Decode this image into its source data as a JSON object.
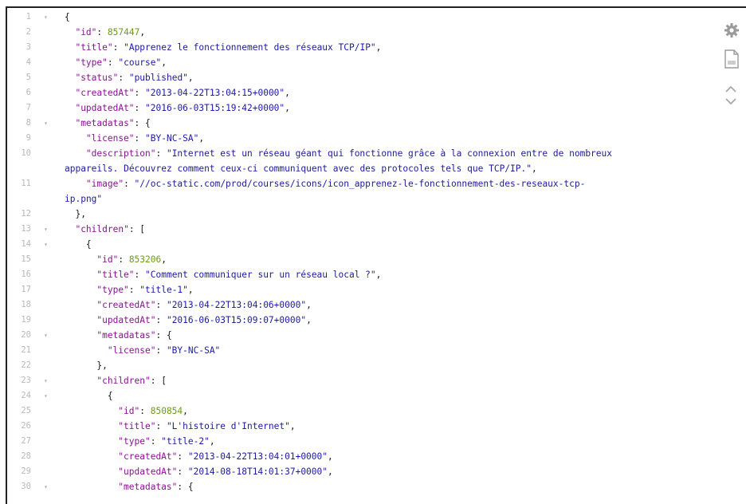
{
  "lines": [
    {
      "n": "1",
      "fold": true,
      "parts": [
        [
          "p",
          "{"
        ]
      ],
      "indent": 0
    },
    {
      "n": "2",
      "parts": [
        [
          "k",
          "\"id\""
        ],
        [
          "p",
          ": "
        ],
        [
          "n",
          "857447"
        ],
        [
          "p",
          ","
        ]
      ],
      "indent": 1
    },
    {
      "n": "3",
      "parts": [
        [
          "k",
          "\"title\""
        ],
        [
          "p",
          ": "
        ],
        [
          "s",
          "\"Apprenez le fonctionnement des réseaux TCP/IP\""
        ],
        [
          "p",
          ","
        ]
      ],
      "indent": 1
    },
    {
      "n": "4",
      "parts": [
        [
          "k",
          "\"type\""
        ],
        [
          "p",
          ": "
        ],
        [
          "s",
          "\"course\""
        ],
        [
          "p",
          ","
        ]
      ],
      "indent": 1
    },
    {
      "n": "5",
      "parts": [
        [
          "k",
          "\"status\""
        ],
        [
          "p",
          ": "
        ],
        [
          "s",
          "\"published\""
        ],
        [
          "p",
          ","
        ]
      ],
      "indent": 1
    },
    {
      "n": "6",
      "parts": [
        [
          "k",
          "\"createdAt\""
        ],
        [
          "p",
          ": "
        ],
        [
          "s",
          "\"2013-04-22T13:04:15+0000\""
        ],
        [
          "p",
          ","
        ]
      ],
      "indent": 1
    },
    {
      "n": "7",
      "parts": [
        [
          "k",
          "\"updatedAt\""
        ],
        [
          "p",
          ": "
        ],
        [
          "s",
          "\"2016-06-03T15:19:42+0000\""
        ],
        [
          "p",
          ","
        ]
      ],
      "indent": 1
    },
    {
      "n": "8",
      "fold": true,
      "parts": [
        [
          "k",
          "\"metadatas\""
        ],
        [
          "p",
          ": {"
        ]
      ],
      "indent": 1
    },
    {
      "n": "9",
      "parts": [
        [
          "k",
          "\"license\""
        ],
        [
          "p",
          ": "
        ],
        [
          "s",
          "\"BY-NC-SA\""
        ],
        [
          "p",
          ","
        ]
      ],
      "indent": 2
    },
    {
      "n": "10",
      "parts": [
        [
          "k",
          "\"description\""
        ],
        [
          "p",
          ": "
        ],
        [
          "s",
          "\"Internet est un réseau géant qui fonctionne grâce à la connexion entre de nombreux"
        ]
      ],
      "indent": 2
    },
    {
      "n": "",
      "cont": true,
      "parts": [
        [
          "s",
          "appareils. Découvrez comment ceux-ci communiquent avec des protocoles tels que TCP/IP.\""
        ],
        [
          "p",
          ","
        ]
      ],
      "indent": 0
    },
    {
      "n": "11",
      "parts": [
        [
          "k",
          "\"image\""
        ],
        [
          "p",
          ": "
        ],
        [
          "s",
          "\"//oc-static.com/prod/courses/icons/icon_apprenez-le-fonctionnement-des-reseaux-tcp-"
        ]
      ],
      "indent": 2
    },
    {
      "n": "",
      "cont": true,
      "parts": [
        [
          "s",
          "ip.png\""
        ]
      ],
      "indent": 0
    },
    {
      "n": "12",
      "parts": [
        [
          "p",
          "},"
        ]
      ],
      "indent": 1
    },
    {
      "n": "13",
      "fold": true,
      "parts": [
        [
          "k",
          "\"children\""
        ],
        [
          "p",
          ": ["
        ]
      ],
      "indent": 1
    },
    {
      "n": "14",
      "fold": true,
      "parts": [
        [
          "p",
          "{"
        ]
      ],
      "indent": 2
    },
    {
      "n": "15",
      "parts": [
        [
          "k",
          "\"id\""
        ],
        [
          "p",
          ": "
        ],
        [
          "n",
          "853206"
        ],
        [
          "p",
          ","
        ]
      ],
      "indent": 3
    },
    {
      "n": "16",
      "parts": [
        [
          "k",
          "\"title\""
        ],
        [
          "p",
          ": "
        ],
        [
          "s",
          "\"Comment communiquer sur un réseau local ?\""
        ],
        [
          "p",
          ","
        ]
      ],
      "indent": 3
    },
    {
      "n": "17",
      "parts": [
        [
          "k",
          "\"type\""
        ],
        [
          "p",
          ": "
        ],
        [
          "s",
          "\"title-1\""
        ],
        [
          "p",
          ","
        ]
      ],
      "indent": 3
    },
    {
      "n": "18",
      "parts": [
        [
          "k",
          "\"createdAt\""
        ],
        [
          "p",
          ": "
        ],
        [
          "s",
          "\"2013-04-22T13:04:06+0000\""
        ],
        [
          "p",
          ","
        ]
      ],
      "indent": 3
    },
    {
      "n": "19",
      "parts": [
        [
          "k",
          "\"updatedAt\""
        ],
        [
          "p",
          ": "
        ],
        [
          "s",
          "\"2016-06-03T15:09:07+0000\""
        ],
        [
          "p",
          ","
        ]
      ],
      "indent": 3
    },
    {
      "n": "20",
      "fold": true,
      "parts": [
        [
          "k",
          "\"metadatas\""
        ],
        [
          "p",
          ": {"
        ]
      ],
      "indent": 3
    },
    {
      "n": "21",
      "parts": [
        [
          "k",
          "\"license\""
        ],
        [
          "p",
          ": "
        ],
        [
          "s",
          "\"BY-NC-SA\""
        ]
      ],
      "indent": 4
    },
    {
      "n": "22",
      "parts": [
        [
          "p",
          "},"
        ]
      ],
      "indent": 3
    },
    {
      "n": "23",
      "fold": true,
      "parts": [
        [
          "k",
          "\"children\""
        ],
        [
          "p",
          ": ["
        ]
      ],
      "indent": 3
    },
    {
      "n": "24",
      "fold": true,
      "parts": [
        [
          "p",
          "{"
        ]
      ],
      "indent": 4
    },
    {
      "n": "25",
      "parts": [
        [
          "k",
          "\"id\""
        ],
        [
          "p",
          ": "
        ],
        [
          "n",
          "850854"
        ],
        [
          "p",
          ","
        ]
      ],
      "indent": 5
    },
    {
      "n": "26",
      "parts": [
        [
          "k",
          "\"title\""
        ],
        [
          "p",
          ": "
        ],
        [
          "s",
          "\"L'histoire d'Internet\""
        ],
        [
          "p",
          ","
        ]
      ],
      "indent": 5
    },
    {
      "n": "27",
      "parts": [
        [
          "k",
          "\"type\""
        ],
        [
          "p",
          ": "
        ],
        [
          "s",
          "\"title-2\""
        ],
        [
          "p",
          ","
        ]
      ],
      "indent": 5
    },
    {
      "n": "28",
      "parts": [
        [
          "k",
          "\"createdAt\""
        ],
        [
          "p",
          ": "
        ],
        [
          "s",
          "\"2013-04-22T13:04:01+0000\""
        ],
        [
          "p",
          ","
        ]
      ],
      "indent": 5
    },
    {
      "n": "29",
      "parts": [
        [
          "k",
          "\"updatedAt\""
        ],
        [
          "p",
          ": "
        ],
        [
          "s",
          "\"2014-08-18T14:01:37+0000\""
        ],
        [
          "p",
          ","
        ]
      ],
      "indent": 5
    },
    {
      "n": "30",
      "fold": true,
      "parts": [
        [
          "k",
          "\"metadatas\""
        ],
        [
          "p",
          ": {"
        ]
      ],
      "indent": 5
    }
  ],
  "toolbar": {
    "icons": [
      "gear-icon",
      "raw-file-icon",
      "chevron-up-icon",
      "chevron-down-icon"
    ]
  },
  "colors": {
    "key": "#881391",
    "string": "#1c1aa3",
    "number": "#6a9c16",
    "gutter": "#b8b8b8"
  }
}
